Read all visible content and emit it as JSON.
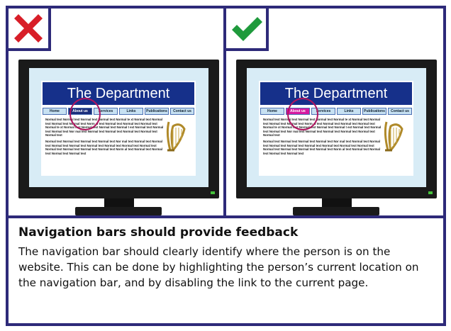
{
  "panels": [
    {
      "verdict": "incorrect",
      "badge_icon": "red-cross-icon",
      "banner_title": "The Department",
      "nav": [
        "Home",
        "About us",
        "Services",
        "Links",
        "Publications",
        "Contact us"
      ],
      "active_style": "dark",
      "paragraph1": "Normal text Normal text Normal text Normal text Normal te xt Normal text Normal text Normal text Normal text Norm al text Normal text Normal text Normal text Normal te xt Normal text Normal text Normal text Normal t ext Normal text Normal text Normal text Nor mal text Normal text Normal text Normal text Normal text Normal text",
      "paragraph2": "Normal text Normal text Normal text Normal text Nor mal text Normal text Normal text Normal text Normal text Normal text Normal text Normal text Normal text Normal text Normal text Normal text Normal text Norm al text Normal text Normal text Normal text Normal text"
    },
    {
      "verdict": "correct",
      "badge_icon": "green-check-icon",
      "banner_title": "The Department",
      "nav": [
        "Home",
        "About us",
        "Services",
        "Links",
        "Publications",
        "Contact us"
      ],
      "active_style": "pink",
      "paragraph1": "Normal text Normal text Normal text Normal text Normal te xt Normal text Normal text Normal text Normal text Norm al text Normal text Normal text Normal text Normal te xt Normal text Normal text Normal text Normal t ext Normal text Normal text Normal text Nor mal text Normal text Normal text Normal text Normal text Normal text",
      "paragraph2": "Normal text Normal text Normal text Normal text Nor mal text Normal text Normal text Normal text Normal text Normal text Normal text Normal text Normal text Normal text Normal text Normal text Normal text Norm al text Normal text Normal text Normal text Normal text"
    }
  ],
  "caption": {
    "title": "Navigation bars should provide feedback",
    "body": "The navigation bar should clearly identify where the person is on the website. This can be done by highlighting the person’s current location on the navigation bar, and by disabling the link to the current page."
  },
  "colors": {
    "frame": "#2e2a79",
    "banner": "#16308a",
    "cross": "#d81e28",
    "check": "#1f9a3c",
    "highlight_circle": "#b0155f",
    "active_pink": "#d61aa0",
    "active_dark": "#1a2d7a"
  }
}
